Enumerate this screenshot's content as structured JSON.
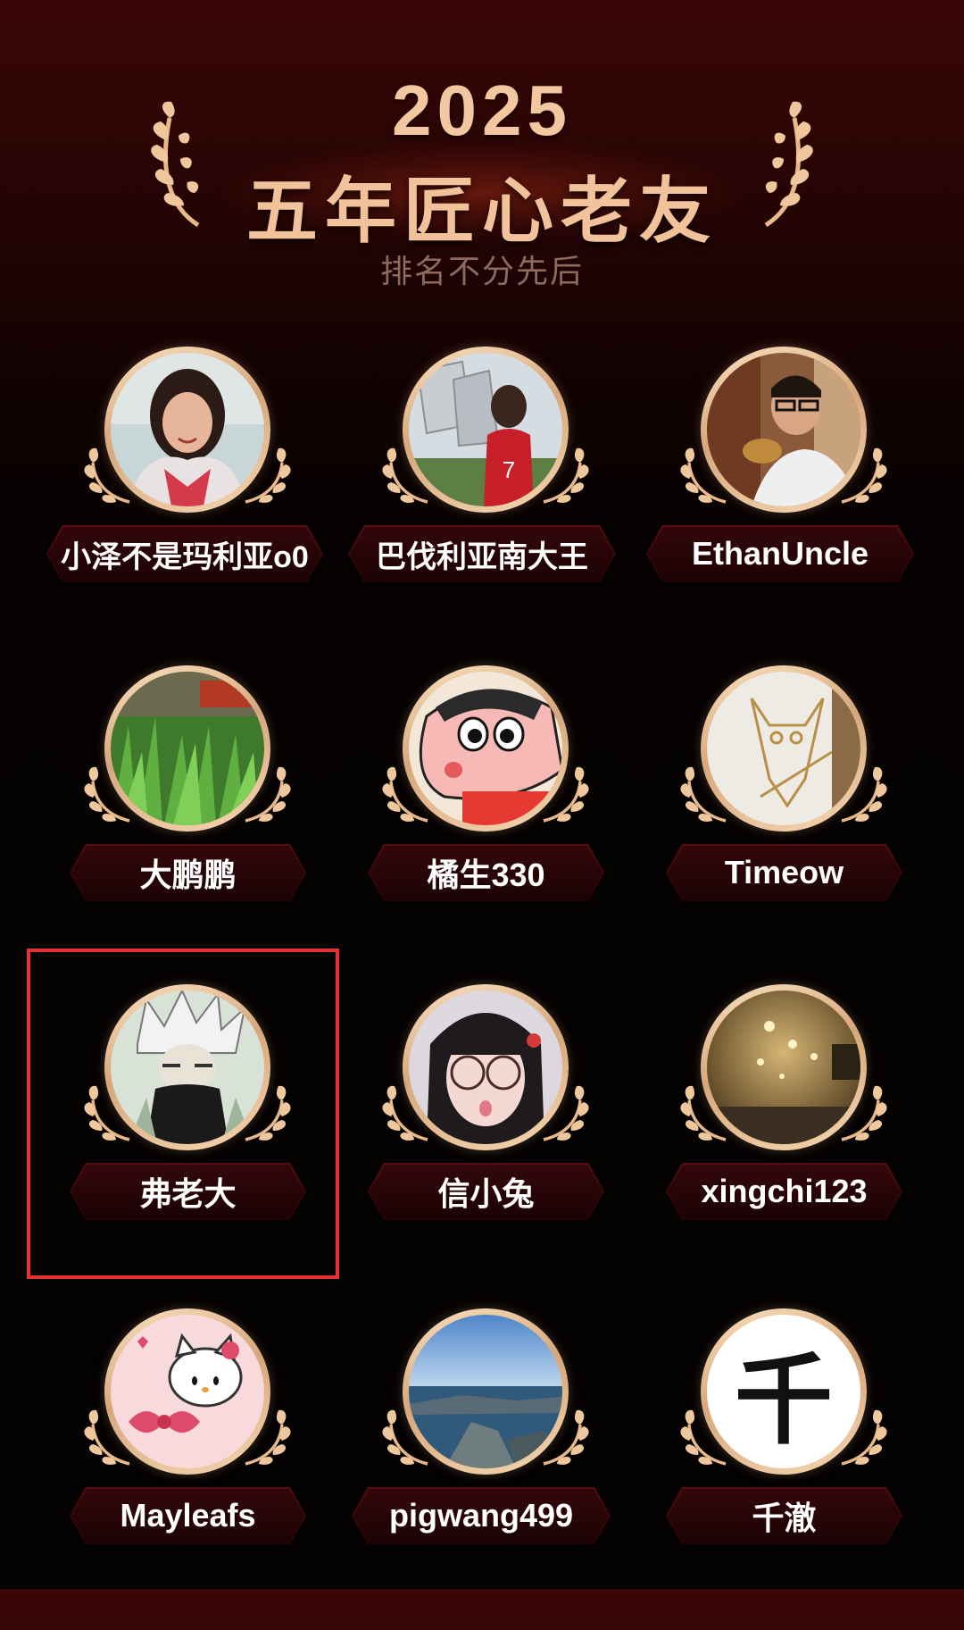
{
  "header": {
    "year": "2025",
    "title": "五年匠心老友",
    "subtitle": "排名不分先后"
  },
  "users": [
    {
      "name": "小泽不是玛利亚o0",
      "avatar": "woman-portrait-avatar"
    },
    {
      "name": "巴伐利亚南大王",
      "avatar": "red-jersey-7-avatar"
    },
    {
      "name": "EthanUncle",
      "avatar": "man-glasses-drinking-avatar"
    },
    {
      "name": "大鹏鹏",
      "avatar": "green-plants-avatar"
    },
    {
      "name": "橘生330",
      "avatar": "crayon-shinchan-avatar"
    },
    {
      "name": "Timeow",
      "avatar": "gold-owl-logo-avatar"
    },
    {
      "name": "弗老大",
      "avatar": "anime-silver-hair-avatar"
    },
    {
      "name": "信小兔",
      "avatar": "girl-round-glasses-avatar"
    },
    {
      "name": "xingchi123",
      "avatar": "foggy-street-lights-avatar"
    },
    {
      "name": "Mayleafs",
      "avatar": "hello-kitty-avatar"
    },
    {
      "name": "pigwang499",
      "avatar": "seaside-rocks-avatar"
    },
    {
      "name": "千澈",
      "avatar": "qian-character-avatar",
      "avatar_char": "千"
    }
  ],
  "colors": {
    "gold": "#f2c29a",
    "highlight": "#e53131",
    "plate": "#3a0609"
  }
}
